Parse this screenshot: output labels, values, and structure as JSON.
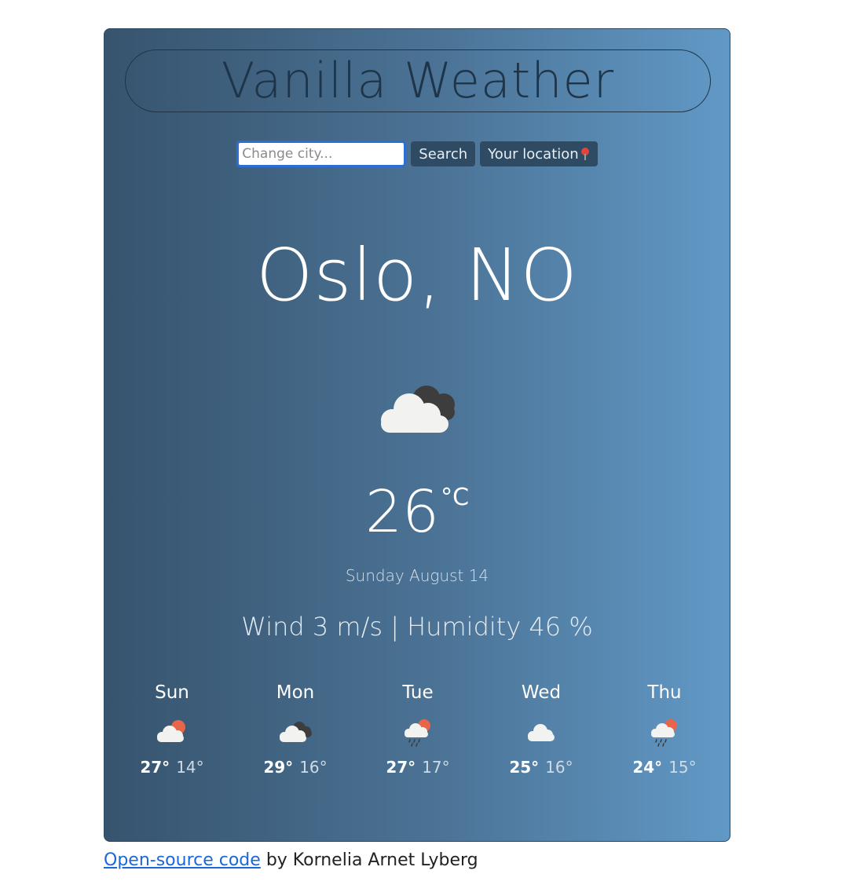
{
  "app": {
    "title": "Vanilla Weather"
  },
  "search": {
    "placeholder": "Change city...",
    "value": "",
    "search_label": "Search",
    "location_label": "Your location"
  },
  "current": {
    "city": "Oslo, NO",
    "icon": "broken-clouds-icon",
    "temperature": "26",
    "unit": "°C",
    "date": "Sunday August 14",
    "details": "Wind 3 m/s | Humidity 46 %"
  },
  "forecast": [
    {
      "day": "Sun",
      "icon": "partly-cloudy-sun-icon",
      "max": "27°",
      "min": "14°"
    },
    {
      "day": "Mon",
      "icon": "broken-clouds-icon",
      "max": "29°",
      "min": "16°"
    },
    {
      "day": "Tue",
      "icon": "rain-sun-icon",
      "max": "27°",
      "min": "17°"
    },
    {
      "day": "Wed",
      "icon": "cloud-icon",
      "max": "25°",
      "min": "16°"
    },
    {
      "day": "Thu",
      "icon": "rain-sun-icon",
      "max": "24°",
      "min": "15°"
    }
  ],
  "footer": {
    "link_text": "Open-source code",
    "suffix": "by Kornelia Arnet Lyberg"
  },
  "colors": {
    "card_gradient_start": "#37546e",
    "card_gradient_end": "#6199c6",
    "button_bg": "#2e4b63",
    "link": "#1a68d8",
    "sun": "#e8654a"
  }
}
